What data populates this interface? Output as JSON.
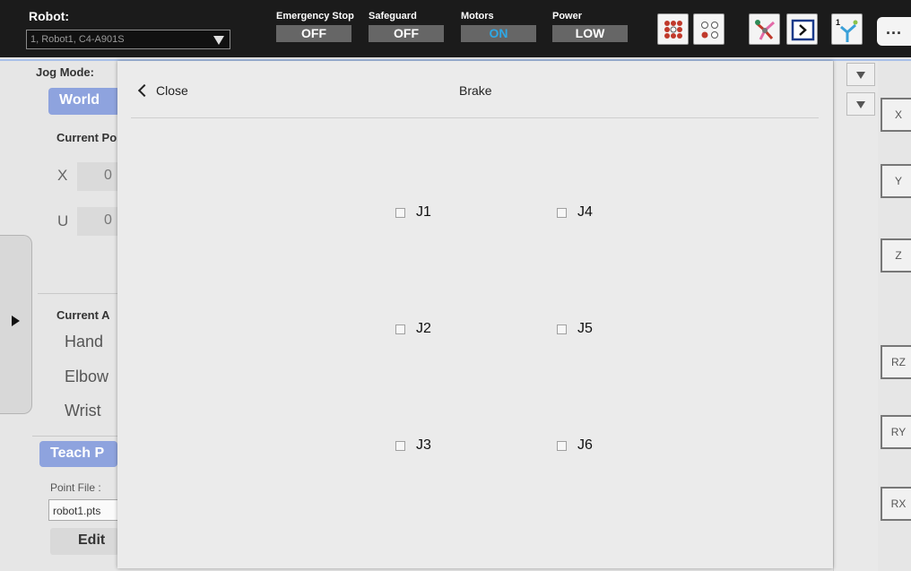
{
  "topbar": {
    "robot_label": "Robot:",
    "robot_value": "1, Robot1, C4-A901S",
    "statuses": [
      {
        "label": "Emergency Stop",
        "value": "OFF"
      },
      {
        "label": "Safeguard",
        "value": "OFF"
      },
      {
        "label": "Motors",
        "value": "ON"
      },
      {
        "label": "Power",
        "value": "LOW"
      }
    ],
    "more_label": "..."
  },
  "background": {
    "jog_mode_label": "Jog Mode:",
    "world_button": "World",
    "current_position_label": "Current Po",
    "x_label": "X",
    "x_value": "0",
    "u_label": "U",
    "u_value": "0",
    "current_arm_label": "Current A",
    "hand_label": "Hand",
    "elbow_label": "Elbow",
    "wrist_label": "Wrist",
    "teach_button": "Teach P",
    "point_file_label": "Point File :",
    "point_file_value": "robot1.pts",
    "edit_button": "Edit",
    "right_axes": [
      "X",
      "Y",
      "Z",
      "RZ",
      "RY",
      "RX"
    ]
  },
  "modal": {
    "close_label": "Close",
    "title": "Brake",
    "joints": [
      "J1",
      "J2",
      "J3",
      "J4",
      "J5",
      "J6"
    ]
  },
  "colors": {
    "accent": "#8ea3de",
    "motors_on": "#2ea8e6",
    "topbar": "#1b1b1b"
  }
}
